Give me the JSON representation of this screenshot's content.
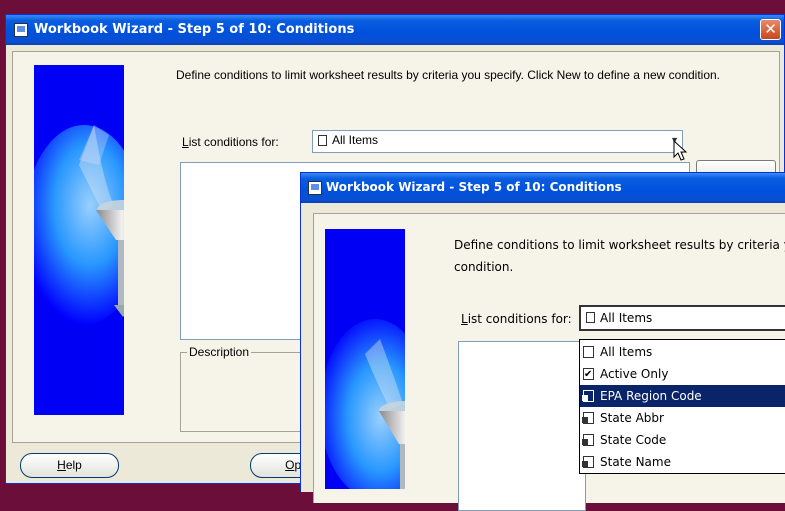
{
  "back_window": {
    "title": "Workbook Wizard - Step 5 of 10: Conditions",
    "close_glyph": "✕",
    "description": "Define conditions to limit worksheet results by criteria you specify. Click New to define a new condition.",
    "list_label_prefix": "",
    "list_label_hotkey": "L",
    "list_label_rest": "ist conditions for:",
    "combo_value": "All Items",
    "group_description": "Description",
    "help_button": "Help",
    "help_hotkey": "H",
    "help_rest": "elp",
    "options_button_partial": "Optio",
    "options_hotkey": "O",
    "options_rest": "ptio"
  },
  "front_window": {
    "title": "Workbook Wizard - Step 5 of 10: Conditions",
    "description": "Define conditions to limit worksheet results by criteria you sp condition.",
    "description_line1": "Define conditions to limit worksheet results by criteria you sp",
    "description_line2": "condition.",
    "list_label_hotkey": "L",
    "list_label_rest": "ist conditions for:",
    "combo_value": "All Items",
    "dropdown_items": [
      {
        "label": "All Items",
        "icon": "document-icon",
        "selected": false
      },
      {
        "label": "Active Only",
        "icon": "checkbox-icon",
        "selected": false
      },
      {
        "label": "EPA Region Code",
        "icon": "locked-item-icon",
        "selected": true
      },
      {
        "label": "State Abbr",
        "icon": "locked-item-icon",
        "selected": false
      },
      {
        "label": "State Code",
        "icon": "locked-item-icon",
        "selected": false
      },
      {
        "label": "State Name",
        "icon": "locked-item-icon",
        "selected": false
      }
    ]
  },
  "colors": {
    "titlebar": "#0050dc",
    "dialog_bg": "#ece9d8",
    "selection": "#0a246a",
    "desktop": "#6b0f3a"
  }
}
